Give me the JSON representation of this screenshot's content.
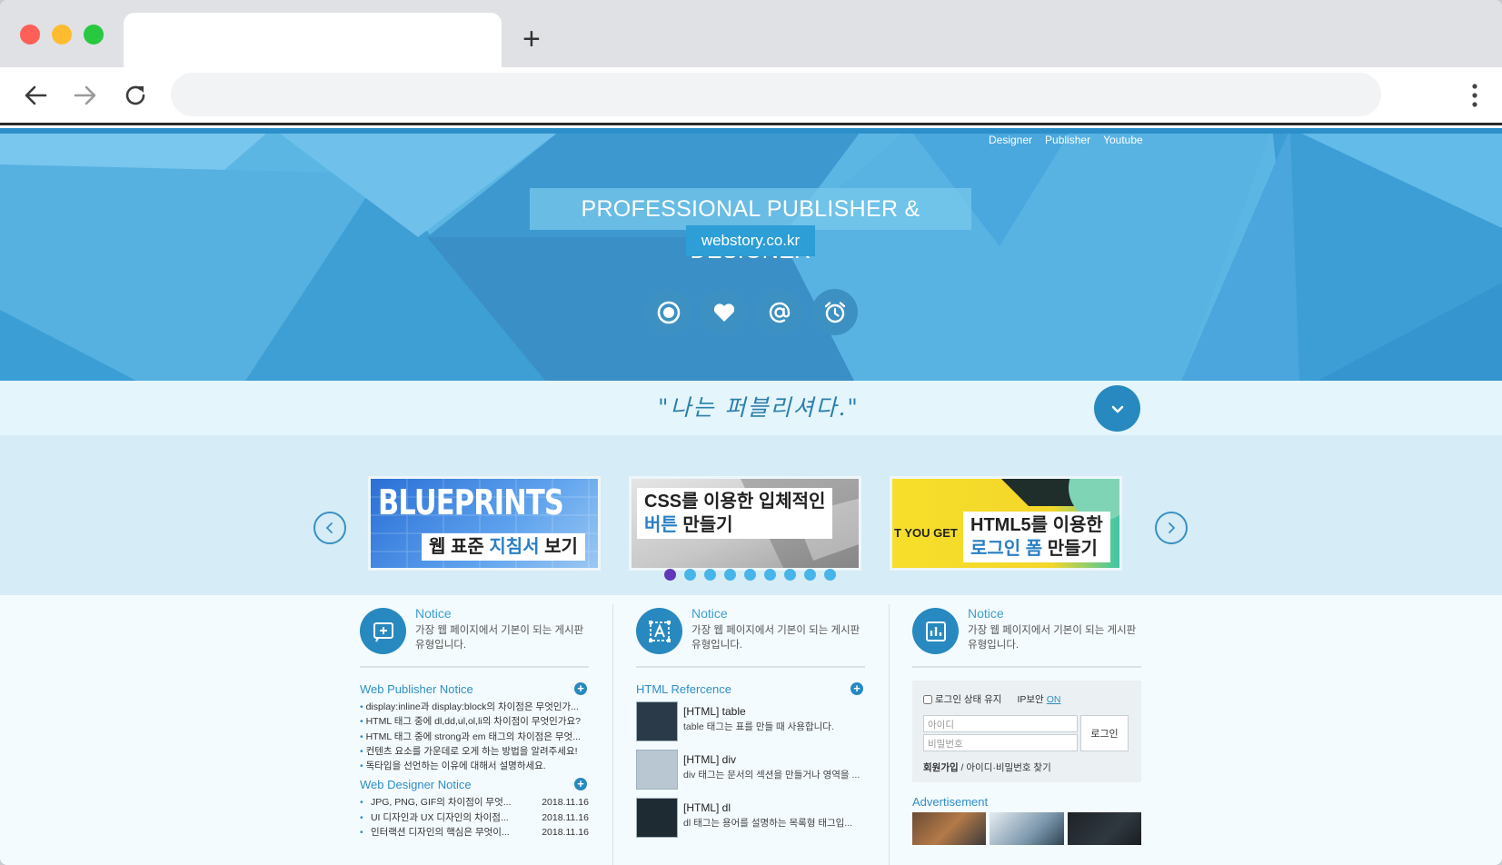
{
  "browser": {
    "new_tab_symbol": "+"
  },
  "topnav": [
    "Designer",
    "Publisher",
    "Youtube"
  ],
  "hero": {
    "title": "PROFESSIONAL PUBLISHER & DESIGNER",
    "subtitle": "webstory.co.kr",
    "icons": [
      "record-icon",
      "heart-icon",
      "at-sign-icon",
      "alarm-clock-icon"
    ]
  },
  "quote": "\"나는 퍼블리셔다.\"",
  "slider": {
    "slides": [
      {
        "big": "BLUEPRINTS",
        "line1_a": "웹 표준 ",
        "line1_hl": "지침서",
        "line1_b": " 보기"
      },
      {
        "line1": "CSS를 이용한 입체적인",
        "line2_hl": "버튼",
        "line2_b": " 만들기"
      },
      {
        "side": "T YOU GET",
        "line1": "HTML5를 이용한",
        "line2_hl": "로그인 폼",
        "line2_b": " 만들기"
      }
    ],
    "dots_total": 9,
    "active_dot": 1
  },
  "columns": [
    {
      "icon": "add-box-icon",
      "title": "Notice",
      "desc": "가장 웹 페이지에서 기본이 되는 게시판 유형입니다.",
      "sections": [
        {
          "title": "Web Publisher Notice",
          "items": [
            "display:inline과 display:block의 차이점은 무엇인가...",
            "HTML 태그 중에 dl,dd,ul,ol,li의 차이점이 무엇인가요?",
            "HTML 태그 중에 strong과 em 태그의 차이점은 무엇...",
            "컨텐츠 요소를 가운데로 오게 하는 방법을 알려주세요!",
            "독타입을 선언하는 이유에 대해서 설명하세요."
          ]
        },
        {
          "title": "Web Designer Notice",
          "items": [
            {
              "text": "JPG, PNG, GIF의 차이점이 무엇...",
              "date": "2018.11.16"
            },
            {
              "text": "UI 디자인과 UX 디자인의 차이점...",
              "date": "2018.11.16"
            },
            {
              "text": "인터랙션 디자인의 핵심은 무엇이...",
              "date": "2018.11.16"
            }
          ]
        }
      ]
    },
    {
      "icon": "text-select-icon",
      "title": "Notice",
      "desc": "가장 웹 페이지에서 기본이 되는 게시판 유형입니다.",
      "section_title": "HTML Refercence",
      "refs": [
        {
          "title": "[HTML] table",
          "desc": "table 태그는 표를 만들 때 사용합니다."
        },
        {
          "title": "[HTML] div",
          "desc": "div 태그는 문서의 섹션을 만들거나 영역을 ..."
        },
        {
          "title": "[HTML] dl",
          "desc": "dl 태그는 용어를 설명하는 목록형 태그입..."
        }
      ]
    },
    {
      "icon": "bar-chart-icon",
      "title": "Notice",
      "desc": "가장 웹 페이지에서 기본이 되는 게시판 유형입니다.",
      "login": {
        "remember": "로그인 상태 유지",
        "ipsec": "IP보안",
        "ipsec_state": "ON",
        "id_placeholder": "아이디",
        "pw_placeholder": "비밀번호",
        "button": "로그인",
        "join": "회원가입",
        "find": " / 아이디·비밀번호 찾기"
      },
      "ad_title": "Advertisement"
    }
  ],
  "colors": {
    "hero_bg": "#5cb6e4",
    "accent": "#2789bf",
    "link": "#2e8fc8",
    "active_dot": "#6138b9"
  }
}
